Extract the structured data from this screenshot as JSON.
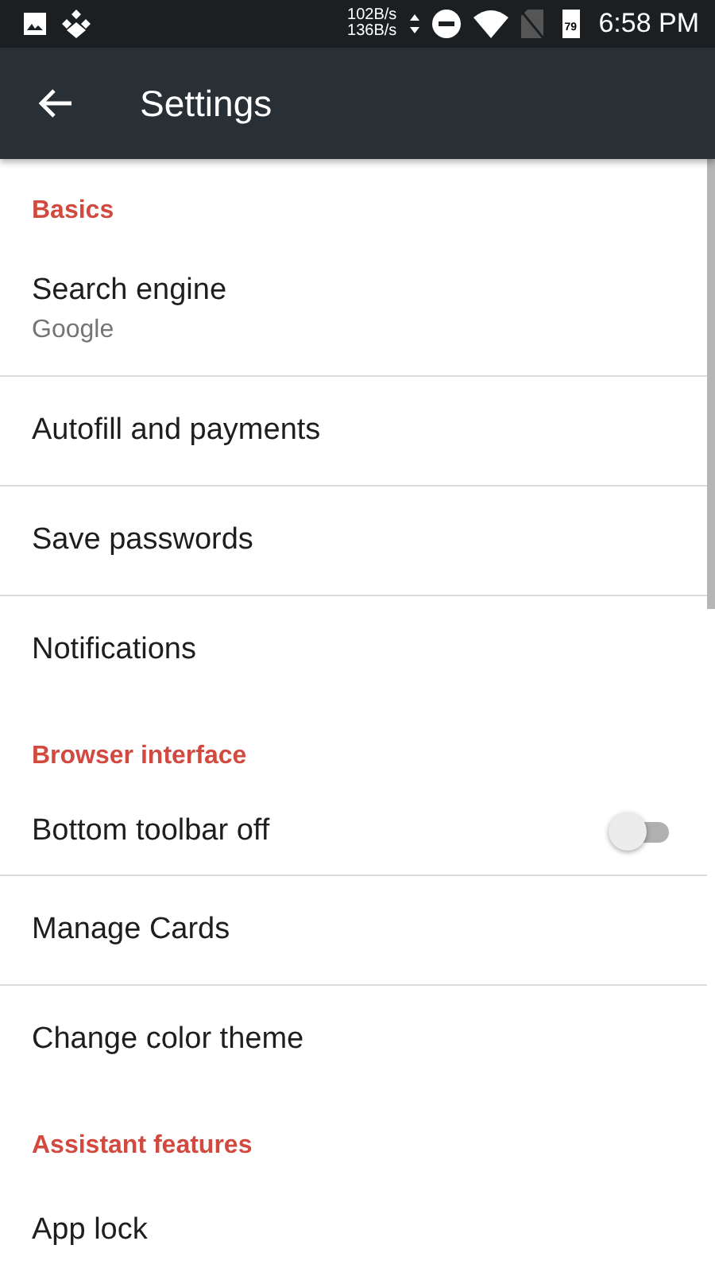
{
  "status_bar": {
    "net_up": "102B/s",
    "net_down": "136B/s",
    "battery": "79",
    "time": "6:58 PM"
  },
  "toolbar": {
    "title": "Settings"
  },
  "items": [
    {
      "kind": "header",
      "label": "Basics"
    },
    {
      "kind": "item",
      "label": "Search engine",
      "summary": "Google"
    },
    {
      "kind": "item",
      "label": "Autofill and payments"
    },
    {
      "kind": "item",
      "label": "Save passwords"
    },
    {
      "kind": "item",
      "label": "Notifications"
    },
    {
      "kind": "header",
      "label": "Browser interface"
    },
    {
      "kind": "toggle",
      "label": "Bottom toolbar off",
      "on": false
    },
    {
      "kind": "item",
      "label": "Manage Cards"
    },
    {
      "kind": "item",
      "label": "Change color theme"
    },
    {
      "kind": "header",
      "label": "Assistant features"
    },
    {
      "kind": "item",
      "label": "App lock"
    }
  ]
}
